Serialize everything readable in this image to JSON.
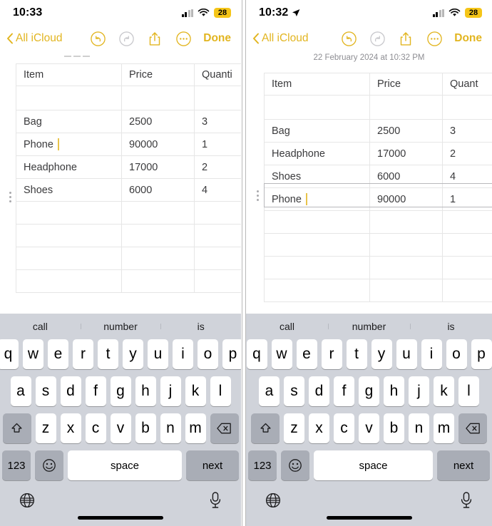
{
  "panels": [
    {
      "id": "left",
      "status": {
        "time": "10:33",
        "location_arrow": false,
        "battery": "28"
      },
      "toolbar": {
        "back_label": "All iCloud",
        "done_label": "Done",
        "undo_icon": "undo-icon",
        "redo_icon": "redo-icon",
        "share_icon": "share-icon",
        "more_icon": "more-icon",
        "redo_disabled": true
      },
      "doc_date": "",
      "table": {
        "headers": [
          "Item",
          "Price",
          "Quantity"
        ],
        "header_visible": [
          "Item",
          "Price",
          "Quanti"
        ],
        "rows": [
          {
            "cells": [
              "",
              "",
              ""
            ],
            "handle": false,
            "selected": false,
            "caret": false
          },
          {
            "cells": [
              "Bag",
              "2500",
              "3"
            ],
            "handle": false,
            "selected": false,
            "caret": false
          },
          {
            "cells": [
              "Phone",
              "90000",
              "1"
            ],
            "handle": true,
            "selected": false,
            "caret": true
          },
          {
            "cells": [
              "Headphone",
              "17000",
              "2"
            ],
            "handle": false,
            "selected": false,
            "caret": false
          },
          {
            "cells": [
              "Shoes",
              "6000",
              "4"
            ],
            "handle": false,
            "selected": false,
            "caret": false
          },
          {
            "cells": [
              "",
              "",
              ""
            ],
            "handle": false,
            "selected": false,
            "caret": false
          },
          {
            "cells": [
              "",
              "",
              ""
            ],
            "handle": false,
            "selected": false,
            "caret": false
          },
          {
            "cells": [
              "",
              "",
              ""
            ],
            "handle": false,
            "selected": false,
            "caret": false
          },
          {
            "cells": [
              "",
              "",
              ""
            ],
            "handle": false,
            "selected": false,
            "caret": false
          }
        ]
      },
      "fab": {
        "icon": "plus-icon"
      },
      "keyboard": {
        "predictions": [
          "call",
          "number",
          "is"
        ],
        "row1": [
          "q",
          "w",
          "e",
          "r",
          "t",
          "y",
          "u",
          "i",
          "o",
          "p"
        ],
        "row2": [
          "a",
          "s",
          "d",
          "f",
          "g",
          "h",
          "j",
          "k",
          "l"
        ],
        "row3": [
          "z",
          "x",
          "c",
          "v",
          "b",
          "n",
          "m"
        ],
        "shift_icon": "shift-icon",
        "delete_icon": "delete-icon",
        "num_label": "123",
        "emoji_icon": "emoji-icon",
        "space_label": "space",
        "next_label": "next",
        "globe_icon": "globe-icon",
        "mic_icon": "microphone-icon"
      }
    },
    {
      "id": "right",
      "status": {
        "time": "10:32",
        "location_arrow": true,
        "battery": "28"
      },
      "toolbar": {
        "back_label": "All iCloud",
        "done_label": "Done",
        "undo_icon": "undo-icon",
        "redo_icon": "redo-icon",
        "share_icon": "share-icon",
        "more_icon": "more-icon",
        "redo_disabled": true
      },
      "doc_date": "22 February 2024 at 10:32 PM",
      "table": {
        "headers": [
          "Item",
          "Price",
          "Quantity"
        ],
        "header_visible": [
          "Item",
          "Price",
          "Quant"
        ],
        "rows": [
          {
            "cells": [
              "",
              "",
              ""
            ],
            "handle": false,
            "selected": false,
            "caret": false
          },
          {
            "cells": [
              "Bag",
              "2500",
              "3"
            ],
            "handle": false,
            "selected": false,
            "caret": false
          },
          {
            "cells": [
              "Headphone",
              "17000",
              "2"
            ],
            "handle": false,
            "selected": false,
            "caret": false
          },
          {
            "cells": [
              "Shoes",
              "6000",
              "4"
            ],
            "handle": false,
            "selected": false,
            "caret": false
          },
          {
            "cells": [
              "Phone",
              "90000",
              "1"
            ],
            "handle": true,
            "selected": true,
            "caret": true
          },
          {
            "cells": [
              "",
              "",
              ""
            ],
            "handle": false,
            "selected": false,
            "caret": false
          },
          {
            "cells": [
              "",
              "",
              ""
            ],
            "handle": false,
            "selected": false,
            "caret": false
          },
          {
            "cells": [
              "",
              "",
              ""
            ],
            "handle": false,
            "selected": false,
            "caret": false
          },
          {
            "cells": [
              "",
              "",
              ""
            ],
            "handle": false,
            "selected": false,
            "caret": false
          }
        ]
      },
      "fab": {
        "icon": "plus-icon"
      },
      "keyboard": {
        "predictions": [
          "call",
          "number",
          "is"
        ],
        "row1": [
          "q",
          "w",
          "e",
          "r",
          "t",
          "y",
          "u",
          "i",
          "o",
          "p"
        ],
        "row2": [
          "a",
          "s",
          "d",
          "f",
          "g",
          "h",
          "j",
          "k",
          "l"
        ],
        "row3": [
          "z",
          "x",
          "c",
          "v",
          "b",
          "n",
          "m"
        ],
        "shift_icon": "shift-icon",
        "delete_icon": "delete-icon",
        "num_label": "123",
        "emoji_icon": "emoji-icon",
        "space_label": "space",
        "next_label": "next",
        "globe_icon": "globe-icon",
        "mic_icon": "microphone-icon"
      }
    }
  ],
  "colors": {
    "accent": "#e2b520",
    "caret": "#e8c34a",
    "battery_low_power": "#f5c518",
    "keyboard_bg": "#d0d3da",
    "key_fn": "#a9adb6",
    "fab": "#b0b0b5",
    "grid_line": "#e6e6e6",
    "text": "#3a3a3c"
  }
}
